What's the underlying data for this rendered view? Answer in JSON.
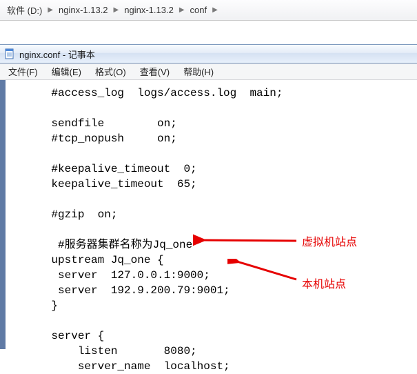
{
  "breadcrumb": {
    "items": [
      "软件 (D:)",
      "nginx-1.13.2",
      "nginx-1.13.2",
      "conf"
    ]
  },
  "window": {
    "title": "nginx.conf - 记事本"
  },
  "menu": {
    "file": "文件(F)",
    "edit": "编辑(E)",
    "format": "格式(O)",
    "view": "查看(V)",
    "help": "帮助(H)"
  },
  "editor": {
    "lines": [
      "    #access_log  logs/access.log  main;",
      "",
      "    sendfile        on;",
      "    #tcp_nopush     on;",
      "",
      "    #keepalive_timeout  0;",
      "    keepalive_timeout  65;",
      "",
      "    #gzip  on;",
      "",
      "     #服务器集群名称为Jq_one",
      "    upstream Jq_one {",
      "     server  127.0.0.1:9000;",
      "     server  192.9.200.79:9001;",
      "    }",
      "",
      "    server {",
      "        listen       8080;",
      "        server_name  localhost;"
    ]
  },
  "annotations": {
    "a1": "虚拟机站点",
    "a2": "本机站点"
  }
}
